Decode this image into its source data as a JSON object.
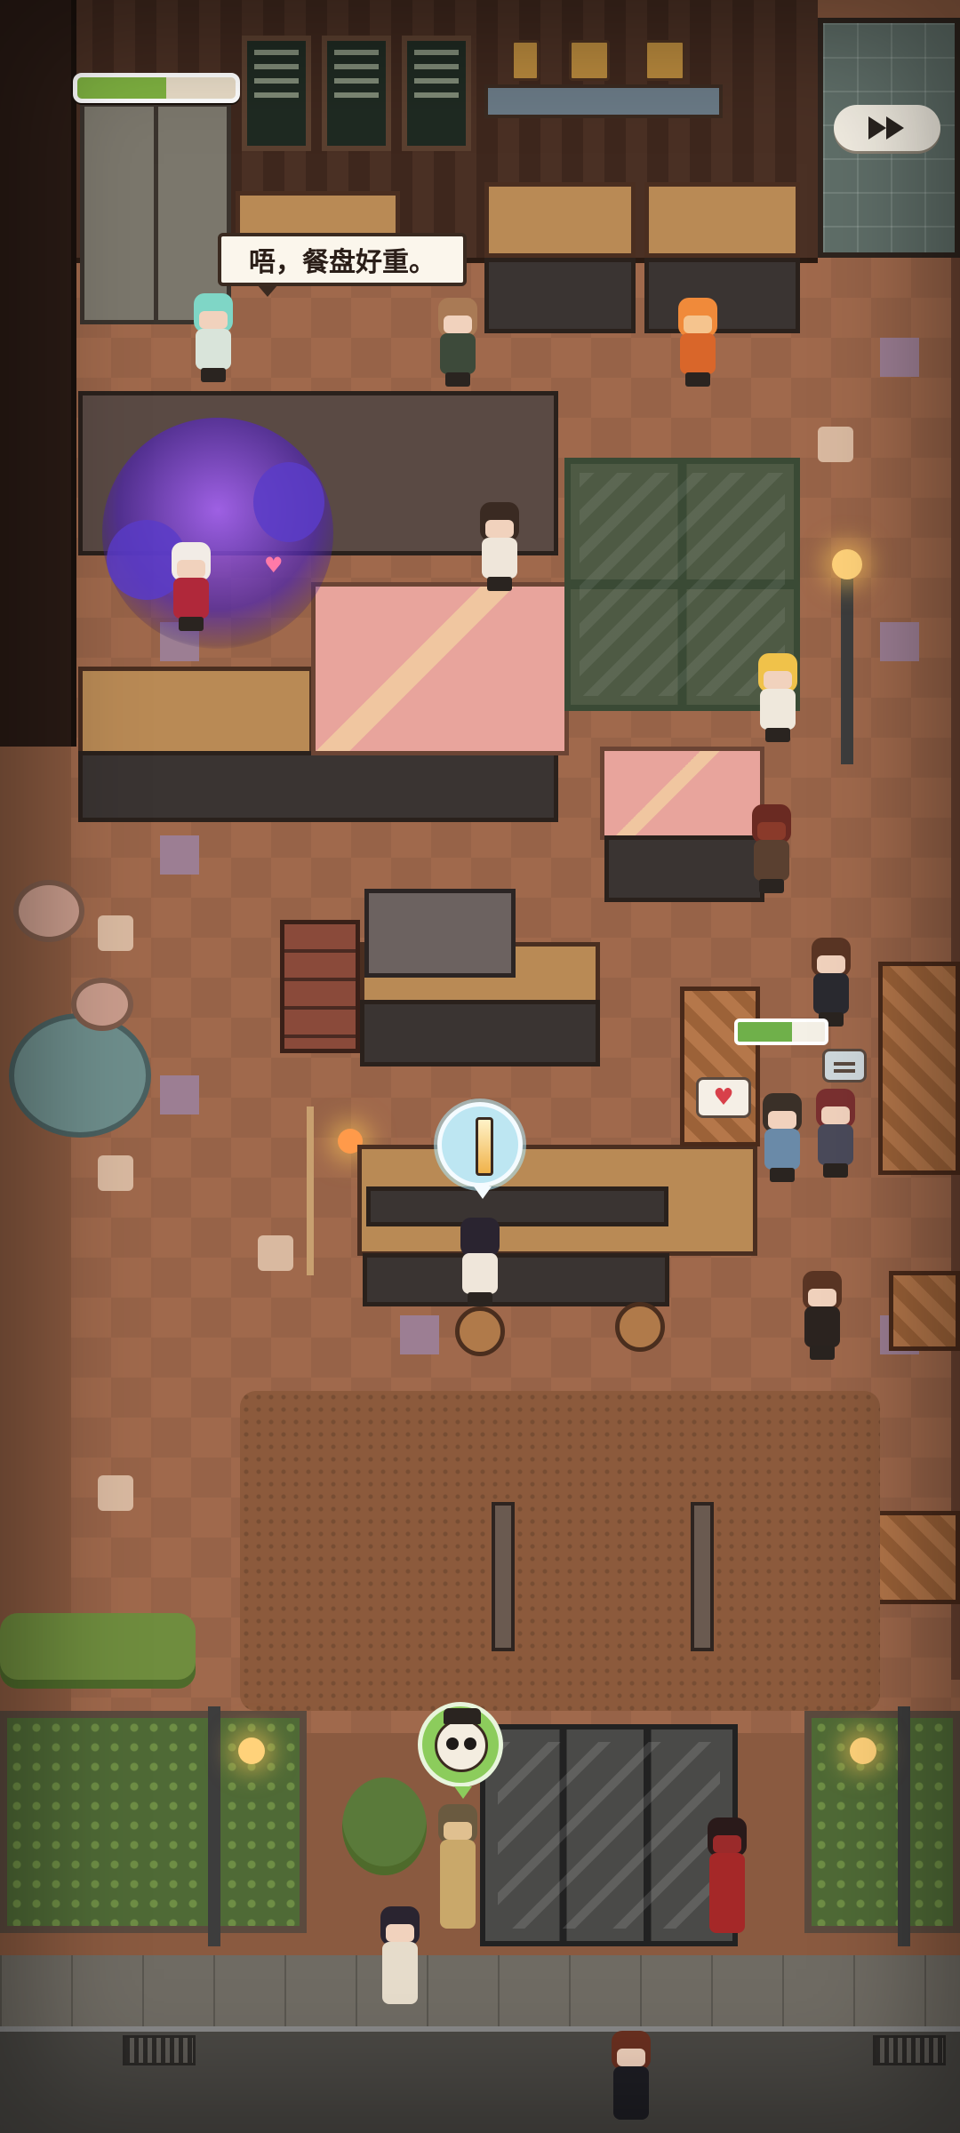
{
  "hud": {
    "progress_fraction": 0.56,
    "progress_color": "#7fb241",
    "fast_forward_icon": "fast-forward-icon"
  },
  "dialogue": {
    "speech_text": "唔，餐盘好重。"
  },
  "scene": {
    "item_bubble_icon": "drink-glass-icon",
    "owl_badge_icon": "owl-icon",
    "customer_mood_fraction": 0.62,
    "heart_icon": "heart-icon",
    "heart_glyph": "♥",
    "chat_icon": "chat-bubble-icon",
    "floating_hearts": "♥"
  },
  "colors": {
    "accent_green": "#7fb241",
    "magic_purple": "#7a4cd8",
    "speech_bg": "#fbf6ec"
  }
}
